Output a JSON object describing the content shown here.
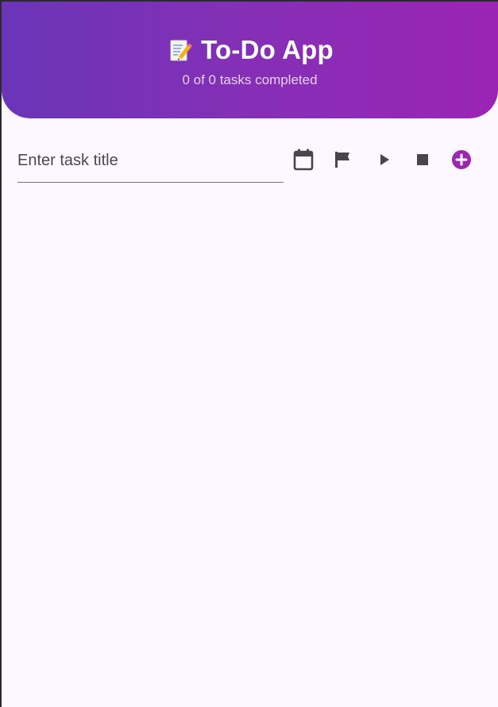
{
  "header": {
    "title": "To-Do App",
    "title_icon": "memo-pencil-icon",
    "subtitle": "0 of 0 tasks completed"
  },
  "task_form": {
    "title_placeholder": "Enter task title",
    "title_value": ""
  },
  "toolbar": {
    "calendar_icon": "calendar-icon",
    "priority_icon": "flag-icon",
    "start_icon": "play-icon",
    "stop_icon": "stop-icon",
    "add_icon": "add-circle-icon"
  },
  "task_list": {
    "items": []
  },
  "colors": {
    "background": "#fdf7ff",
    "header_start": "#6a35b8",
    "header_end": "#9b24b4",
    "accent": "#9c27b0",
    "icon": "#49454f"
  }
}
